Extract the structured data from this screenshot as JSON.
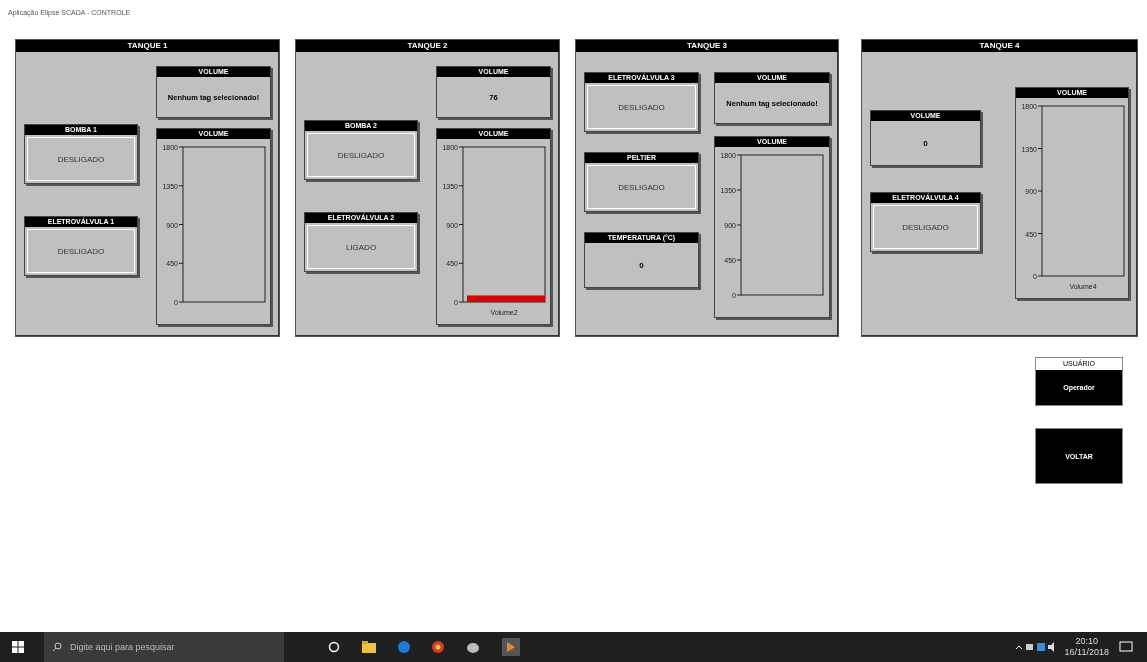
{
  "window": {
    "title": "Aplicação Elipse SCADA - CONTROLE"
  },
  "tanks": [
    {
      "title": "TANQUE 1",
      "widgets": [
        {
          "kind": "status",
          "label": "BOMBA 1",
          "value": "DESLIGADO"
        },
        {
          "kind": "status",
          "label": "ELETROVÁLVULA 1",
          "value": "DESLIGADO"
        }
      ],
      "display": {
        "label": "VOLUME",
        "value": "Nenhum tag selecionado!"
      },
      "gauge": {
        "title": "VOLUME",
        "ticks": [
          "1800",
          "1350",
          "900",
          "450",
          "0"
        ]
      }
    },
    {
      "title": "TANQUE 2",
      "widgets": [
        {
          "kind": "status",
          "label": "BOMBA 2",
          "value": "DESLIGADO"
        },
        {
          "kind": "status",
          "label": "ELETROVÁLVULA 2",
          "value": "LIGADO"
        }
      ],
      "display": {
        "label": "VOLUME",
        "value": "76"
      },
      "chart_data": {
        "type": "bar",
        "title": "VOLUME",
        "categories": [
          "Volume2"
        ],
        "series": [
          {
            "color": "#e00000",
            "values": [
              76
            ]
          }
        ],
        "ylim": [
          0,
          1800
        ],
        "yticks": [
          0,
          450,
          900,
          1350,
          1800
        ]
      }
    },
    {
      "title": "TANQUE 3",
      "widgets": [
        {
          "kind": "status",
          "label": "ELETROVÁLVULA 3",
          "value": "DESLIGADO"
        },
        {
          "kind": "status",
          "label": "PELTIER",
          "value": "DESLIGADO"
        },
        {
          "kind": "reading",
          "label": "TEMPERATURA (°C)",
          "value": "0"
        }
      ],
      "display": {
        "label": "VOLUME",
        "value": "Nenhum tag selecionado!"
      },
      "gauge": {
        "title": "VOLUME",
        "ticks": [
          "1800",
          "1350",
          "900",
          "450",
          "0"
        ]
      }
    },
    {
      "title": "TANQUE 4",
      "widgets": [
        {
          "kind": "reading",
          "label": "VOLUME",
          "value": "0"
        },
        {
          "kind": "status",
          "label": "ELETROVÁLVULA 4",
          "value": "DESLIGADO"
        }
      ],
      "gauge": {
        "title": "VOLUME",
        "ticks": [
          "1800",
          "1350",
          "900",
          "450",
          "0"
        ],
        "caption": "Volume4"
      }
    }
  ],
  "user": {
    "label": "USUÁRIO",
    "value": "Operador"
  },
  "back_button": "VOLTAR",
  "taskbar": {
    "search_placeholder": "Digite aqui para pesquisar",
    "time": "20:10",
    "date": "16/11/2018"
  }
}
